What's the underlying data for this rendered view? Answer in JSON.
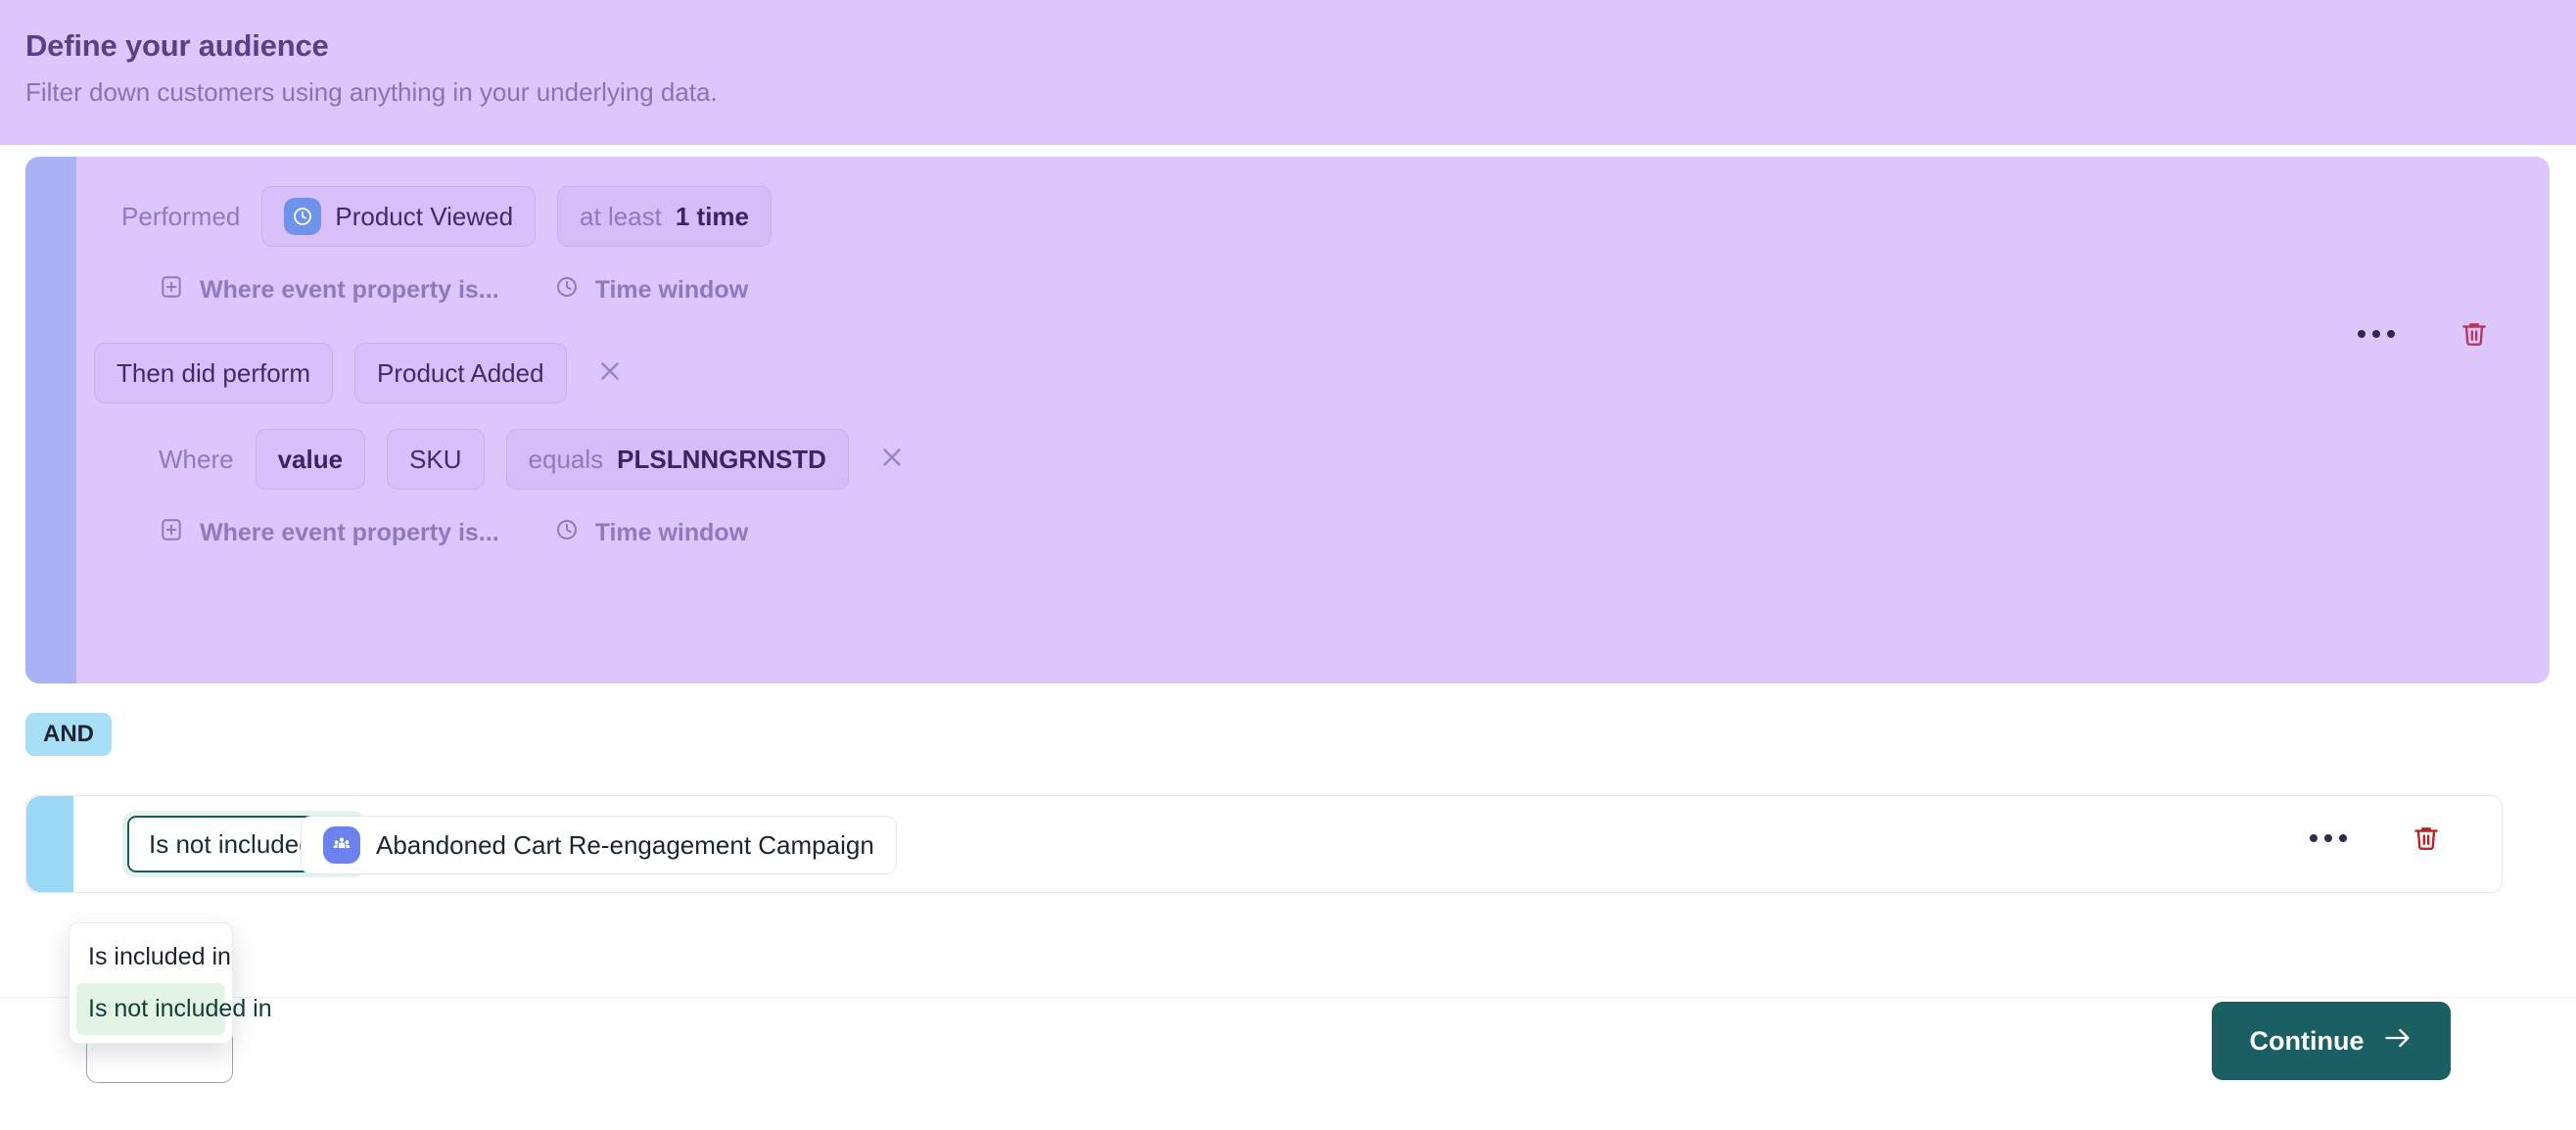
{
  "header": {
    "title": "Define your audience",
    "subtitle": "Filter down customers using anything in your underlying data."
  },
  "event_card": {
    "performed_label": "Performed",
    "event_name": "Product Viewed",
    "event_icon": "clock-icon",
    "frequency_prefix": "at least",
    "frequency_value": "1 time",
    "sub_actions_top": [
      {
        "icon": "plus-square-icon",
        "label": "Where event property is..."
      },
      {
        "icon": "clock-icon",
        "label": "Time window"
      }
    ],
    "then_clause": {
      "operator": "Then did perform",
      "event_name": "Product Added",
      "remove_icon": "close-icon"
    },
    "where_clause": {
      "label": "Where",
      "operand": "value",
      "property": "SKU",
      "comparator": "equals",
      "comparator_value": "PLSLNNGRNSTD",
      "remove_icon": "close-icon"
    },
    "sub_actions_bottom": [
      {
        "icon": "plus-square-icon",
        "label": "Where event property is..."
      },
      {
        "icon": "clock-icon",
        "label": "Time window"
      }
    ],
    "more_icon": "ellipsis-icon",
    "delete_icon": "trash-icon",
    "accent_color": "#a8b2f5",
    "background_color": "#ddc6fb"
  },
  "connector": {
    "label": "AND",
    "color": "#a7dff7"
  },
  "audience_card": {
    "operator_value": "Is not included in",
    "audience_icon": "people-group-icon",
    "audience_name": "Abandoned Cart Re-engagement Campaign",
    "more_icon": "ellipsis-icon",
    "delete_icon": "trash-icon",
    "accent_color": "#9ad8f5"
  },
  "dropdown": {
    "options": [
      {
        "label": "Is included in",
        "selected": false
      },
      {
        "label": "Is not included in",
        "selected": true
      }
    ]
  },
  "footer": {
    "continue_label": "Continue",
    "continue_icon": "arrow-right-icon",
    "continue_color": "#1b5f63"
  }
}
